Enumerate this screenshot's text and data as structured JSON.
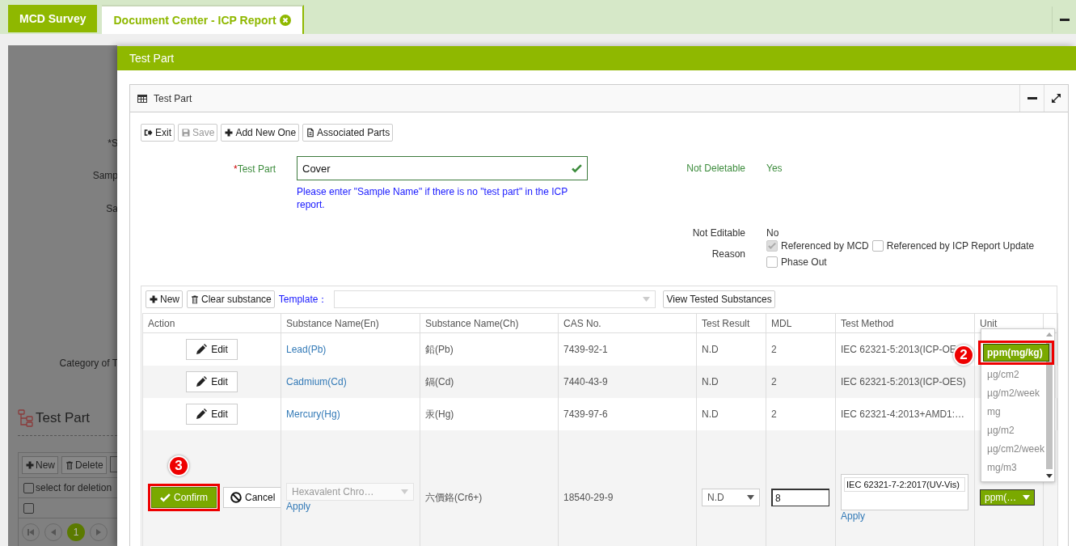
{
  "tabs": [
    {
      "label": "MCD Survey",
      "selected": false,
      "closable": false
    },
    {
      "label": "Document Center - ICP Report",
      "selected": true,
      "closable": true
    }
  ],
  "background_checkboxes": [
    {
      "checked": false
    },
    {
      "checked": false
    }
  ],
  "background_page": {
    "labels": [
      "*S",
      "Samp",
      "Sa",
      "Category of T"
    ],
    "section_title": "Test Part",
    "toolbar": [
      "New",
      "Delete"
    ],
    "select_label": "select for deletion",
    "pager_page": "1"
  },
  "dialog": {
    "title": "Test Part",
    "panel_title": "Test Part",
    "toolbar": [
      {
        "label": "Exit",
        "disabled": false
      },
      {
        "label": "Save",
        "disabled": true
      },
      {
        "label": "Add New One",
        "disabled": false
      },
      {
        "label": "Associated Parts",
        "disabled": false
      }
    ],
    "test_part": {
      "required_mark": "*",
      "label": "Test Part",
      "value": "Cover",
      "valid": true,
      "hint": "Please enter \"Sample Name\" if there is no \"test part\" in the ICP report."
    },
    "info": [
      {
        "label": "Not Deletable",
        "value": "Yes",
        "highlight": true
      },
      {
        "label": "Not Editable",
        "value": "No",
        "highlight": false
      }
    ],
    "reason": {
      "label": "Reason",
      "options": [
        {
          "label": "Referenced by MCD",
          "checked": true,
          "disabled": true
        },
        {
          "label": "Referenced by ICP Report Update",
          "checked": false,
          "disabled": false
        },
        {
          "label": "Phase Out",
          "checked": false,
          "disabled": false
        }
      ]
    },
    "substances": {
      "new_label": "New",
      "clear_label": "Clear substance",
      "template_label": "Template：",
      "view_label": "View Tested Substances",
      "columns": [
        "Action",
        "Substance Name(En)",
        "Substance Name(Ch)",
        "CAS No.",
        "Test Result",
        "MDL",
        "Test Method",
        "Unit"
      ],
      "rows": [
        {
          "action": "Edit",
          "name_en": "Lead(Pb)",
          "name_ch": "鉛(Pb)",
          "cas": "7439-92-1",
          "result": "N.D",
          "mdl": "2",
          "method": "IEC 62321-5:2013(ICP-OE"
        },
        {
          "action": "Edit",
          "name_en": "Cadmium(Cd)",
          "name_ch": "鎘(Cd)",
          "cas": "7440-43-9",
          "result": "N.D",
          "mdl": "2",
          "method": "IEC 62321-5:2013(ICP-OES)"
        },
        {
          "action": "Edit",
          "name_en": "Mercury(Hg)",
          "name_ch": "汞(Hg)",
          "cas": "7439-97-6",
          "result": "N.D",
          "mdl": "2",
          "method": "IEC 62321-4:2013+AMD1:…"
        }
      ],
      "edit_row": {
        "confirm": {
          "label": "Confirm",
          "callout": "3"
        },
        "cancel": "Cancel",
        "name_en": "Hexavalent Chro…",
        "apply": "Apply",
        "name_ch": "六價鉻(Cr6+)",
        "cas": "18540-29-9",
        "result": "N.D",
        "mdl": "8",
        "method": "IEC 62321-7-2:2017(UV-Vis)",
        "method_apply": "Apply",
        "unit": "ppm(…"
      },
      "unit_options": [
        {
          "label": "ppm(mg/kg)",
          "selected": true,
          "callout": "2"
        },
        {
          "label": "µg/cm2",
          "selected": false
        },
        {
          "label": "µg/m2/week",
          "selected": false
        },
        {
          "label": "mg",
          "selected": false
        },
        {
          "label": "µg/m2",
          "selected": false
        },
        {
          "label": "µg/cm2/week",
          "selected": false
        },
        {
          "label": "mg/m3",
          "selected": false
        }
      ]
    }
  }
}
